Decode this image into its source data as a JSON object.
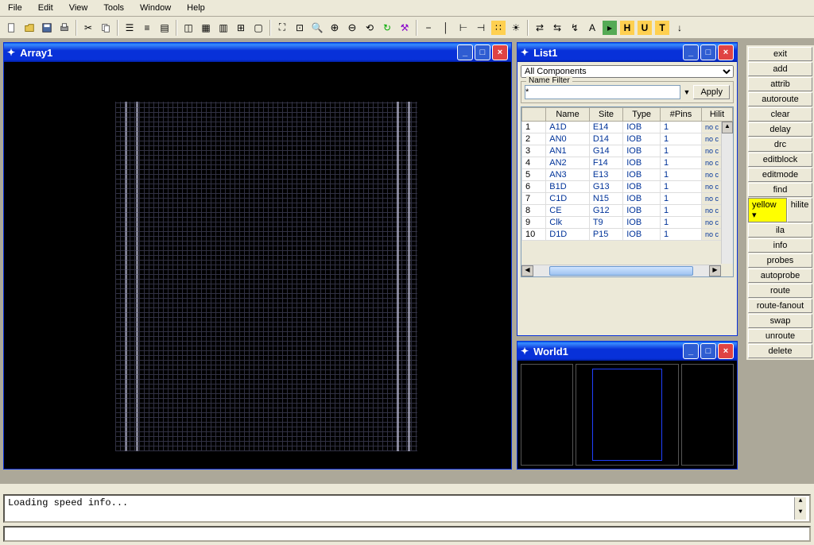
{
  "menu": [
    "File",
    "Edit",
    "View",
    "Tools",
    "Window",
    "Help"
  ],
  "windows": {
    "array": {
      "title": "Array1"
    },
    "list": {
      "title": "List1"
    },
    "world": {
      "title": "World1"
    }
  },
  "list": {
    "combo_value": "All Components",
    "filter_legend": "Name Filter",
    "filter_value": "*",
    "apply_label": "Apply",
    "columns": [
      "",
      "Name",
      "Site",
      "Type",
      "#Pins",
      "Hilit"
    ],
    "rows": [
      {
        "idx": "1",
        "name": "A1D",
        "site": "E14",
        "type": "IOB",
        "pins": "1",
        "hilite": "no c"
      },
      {
        "idx": "2",
        "name": "AN0",
        "site": "D14",
        "type": "IOB",
        "pins": "1",
        "hilite": "no c"
      },
      {
        "idx": "3",
        "name": "AN1",
        "site": "G14",
        "type": "IOB",
        "pins": "1",
        "hilite": "no c"
      },
      {
        "idx": "4",
        "name": "AN2",
        "site": "F14",
        "type": "IOB",
        "pins": "1",
        "hilite": "no c"
      },
      {
        "idx": "5",
        "name": "AN3",
        "site": "E13",
        "type": "IOB",
        "pins": "1",
        "hilite": "no c"
      },
      {
        "idx": "6",
        "name": "B1D",
        "site": "G13",
        "type": "IOB",
        "pins": "1",
        "hilite": "no c"
      },
      {
        "idx": "7",
        "name": "C1D",
        "site": "N15",
        "type": "IOB",
        "pins": "1",
        "hilite": "no c"
      },
      {
        "idx": "8",
        "name": "CE",
        "site": "G12",
        "type": "IOB",
        "pins": "1",
        "hilite": "no c"
      },
      {
        "idx": "9",
        "name": "Clk",
        "site": "T9",
        "type": "IOB",
        "pins": "1",
        "hilite": "no c"
      },
      {
        "idx": "10",
        "name": "D1D",
        "site": "P15",
        "type": "IOB",
        "pins": "1",
        "hilite": "no c"
      }
    ]
  },
  "rightbar": {
    "buttons": [
      "exit",
      "add",
      "attrib",
      "autoroute",
      "clear",
      "delay",
      "drc",
      "editblock",
      "editmode",
      "find"
    ],
    "color_label": "yellow",
    "hilite_label": "hilite",
    "buttons2": [
      "ila",
      "info",
      "probes",
      "autoprobe",
      "route",
      "route-fanout",
      "swap",
      "unroute",
      "delete"
    ]
  },
  "status": {
    "text": "Loading speed info..."
  }
}
